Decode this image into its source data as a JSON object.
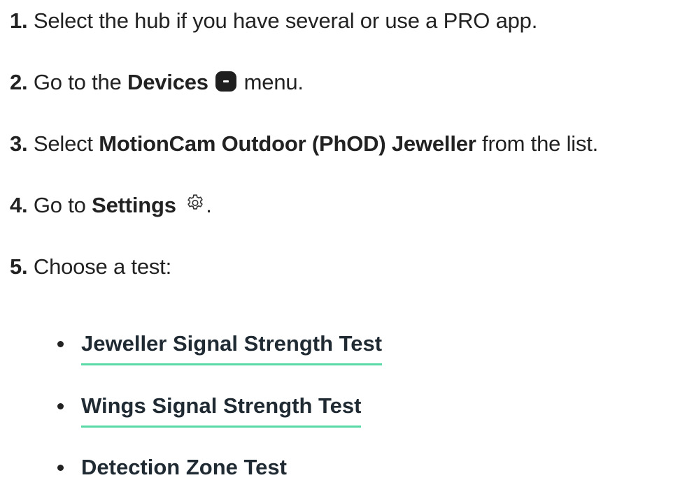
{
  "steps": [
    {
      "number": "1.",
      "text": "Select the hub if you have several or use a PRO app."
    },
    {
      "number": "2.",
      "pre": "Go to the ",
      "bold": "Devices",
      "post": " menu."
    },
    {
      "number": "3.",
      "pre": "Select ",
      "bold": "MotionCam Outdoor (PhOD) Jeweller",
      "post": " from the list."
    },
    {
      "number": "4.",
      "pre": "Go to ",
      "bold": "Settings",
      "post": "."
    },
    {
      "number": "5.",
      "text": "Choose a test:"
    }
  ],
  "tests": [
    {
      "label": "Jeweller Signal Strength Test",
      "link": true
    },
    {
      "label": "Wings Signal Strength Test",
      "link": true
    },
    {
      "label": "Detection Zone Test",
      "link": false
    }
  ],
  "icons": {
    "devices": "devices-icon",
    "settings": "gear-icon"
  },
  "colors": {
    "text": "#222222",
    "link_underline": "#58d9a6",
    "icon_fill": "#1f1f1f"
  }
}
